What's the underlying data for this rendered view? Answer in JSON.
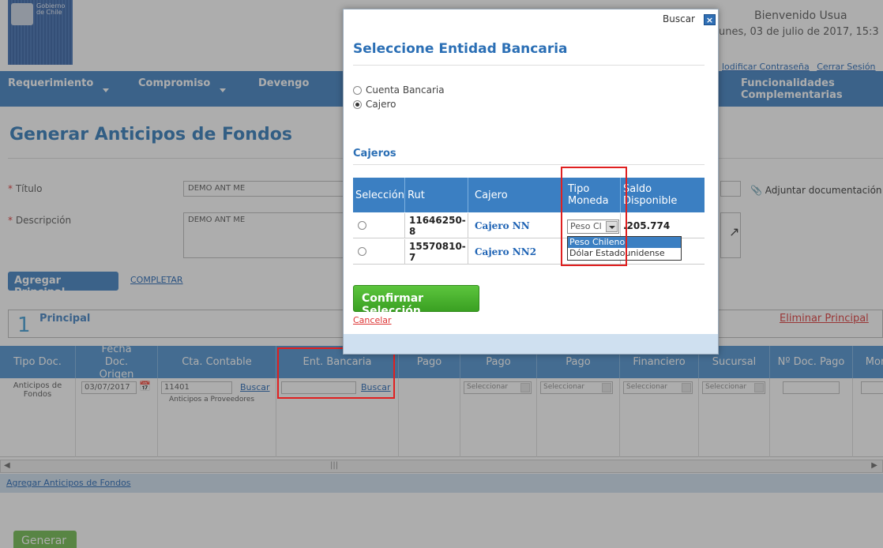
{
  "header": {
    "logo_text": "Gobierno\nde Chile",
    "welcome": "Bienvenido Usua",
    "date": "unes, 03 de julio de 2017, 15:3",
    "links": [
      "lodificar Contraseña",
      "Cerrar Sesión"
    ]
  },
  "nav": {
    "items": [
      "Requerimiento",
      "Compromiso",
      "Devengo",
      "Funcionalidades",
      "Complementarias"
    ]
  },
  "page": {
    "title": "Generar Anticipos de Fondos",
    "titulo_label": "Título",
    "titulo_value": "DEMO ANT ME",
    "descripcion_label": "Descripción",
    "descripcion_value": "DEMO ANT ME",
    "adjuntar": "Adjuntar documentación",
    "add_principal": "Agregar Principal",
    "completar": "COMPLETAR"
  },
  "principal": {
    "number": "1",
    "title": "Principal",
    "delete": "Eliminar Principal"
  },
  "table": {
    "headers": [
      "Tipo Doc.",
      "Fecha Doc. Origen",
      "Cta. Contable",
      "Ent. Bancaria",
      "Pago",
      "Pago",
      "Pago",
      "Financiero",
      "Sucursal",
      "Nº Doc. Pago",
      "Mon"
    ],
    "row": {
      "tipo": "Anticipos de Fondos",
      "fecha": "03/07/2017",
      "cuenta": "11401",
      "cuenta_desc": "Anticipos a Proveedores",
      "buscar": "Buscar",
      "select_placeholder": "Seleccionar"
    }
  },
  "footer": {
    "agregar": "Agregar Anticipos de Fondos",
    "generar": "Generar"
  },
  "modal": {
    "buscar": "Buscar",
    "close": "×",
    "title": "Seleccione Entidad Bancaria",
    "options": [
      {
        "label": "Cuenta Bancaria",
        "selected": false
      },
      {
        "label": "Cajero",
        "selected": true
      }
    ],
    "section": "Cajeros",
    "headers": [
      "Selección",
      "Rut",
      "Cajero",
      "Tipo Moneda",
      "Saldo Disponible"
    ],
    "rows": [
      {
        "rut": "11646250-8",
        "cajero": "Cajero NN",
        "moneda": "Peso Cl",
        "saldo": ".205.774"
      },
      {
        "rut": "15570810-7",
        "cajero": "Cajero NN2",
        "moneda": "",
        "saldo": ""
      }
    ],
    "dropdown": [
      "Peso Chileno",
      "Dólar Estadounidense"
    ],
    "confirm": "Confirmar Selección",
    "cancel": "Cancelar"
  },
  "colors": {
    "brand": "#3b7fc2",
    "accent_green": "#4fb233",
    "highlight_red": "#e02020"
  }
}
